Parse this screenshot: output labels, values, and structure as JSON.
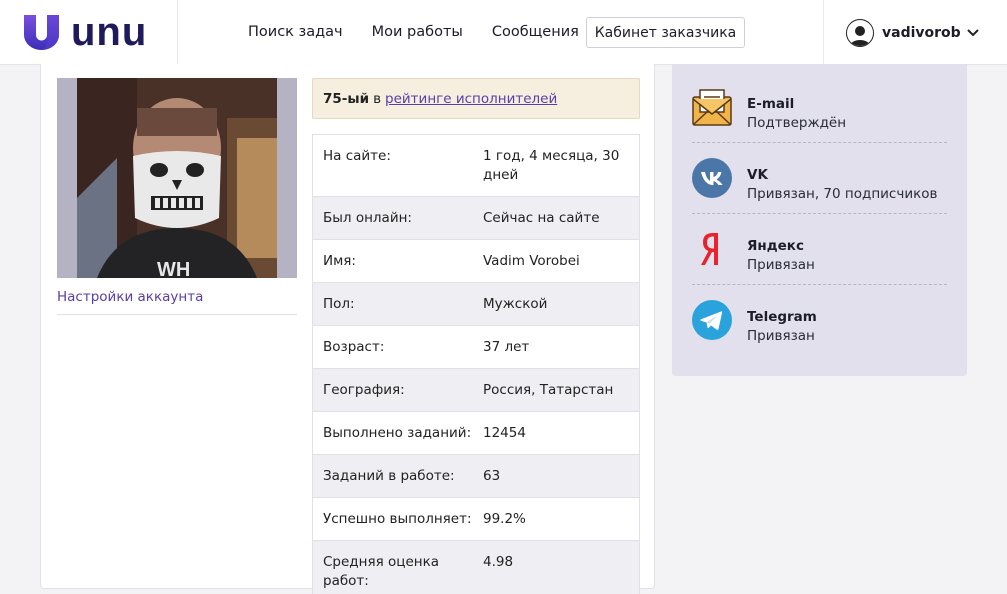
{
  "logo": {
    "text": "unu"
  },
  "nav": {
    "items": [
      {
        "label": "Поиск задач"
      },
      {
        "label": "Мои работы"
      },
      {
        "label": "Сообщения"
      }
    ],
    "customer_button": "Кабинет заказчика"
  },
  "user": {
    "name": "vadivorob"
  },
  "profile": {
    "settings_link": "Настройки аккаунта",
    "rating": {
      "place": "75-ый",
      "middle": "в",
      "link": "рейтинге исполнителей"
    },
    "table": [
      {
        "key": "На сайте:",
        "value": "1 год, 4 месяца, 30 дней"
      },
      {
        "key": "Был онлайн:",
        "value": "Сейчас на сайте"
      },
      {
        "key": "Имя:",
        "value": "Vadim Vorobei"
      },
      {
        "key": "Пол:",
        "value": "Мужской"
      },
      {
        "key": "Возраст:",
        "value": "37 лет"
      },
      {
        "key": "География:",
        "value": "Россия, Татарстан"
      },
      {
        "key": "Выполнено заданий:",
        "value": "12454"
      },
      {
        "key": "Заданий в работе:",
        "value": "63"
      },
      {
        "key": "Успешно выполняет:",
        "value": "99.2%"
      },
      {
        "key": "Средняя оценка работ:",
        "value": "4.98"
      }
    ]
  },
  "verifications": [
    {
      "icon": "email-icon",
      "title": "E-mail",
      "status": "Подтверждён"
    },
    {
      "icon": "vk-icon",
      "title": "VK",
      "status": "Привязан, 70 подписчиков"
    },
    {
      "icon": "yandex-icon",
      "title": "Яндекс",
      "status": "Привязан"
    },
    {
      "icon": "telegram-icon",
      "title": "Telegram",
      "status": "Привязан"
    }
  ],
  "colors": {
    "brand": "#1f1a5c",
    "accent": "#5a3ea8",
    "vk": "#4a76a8",
    "yandex": "#e8232b",
    "telegram": "#2aa3dd",
    "email": "#f0b44a"
  }
}
